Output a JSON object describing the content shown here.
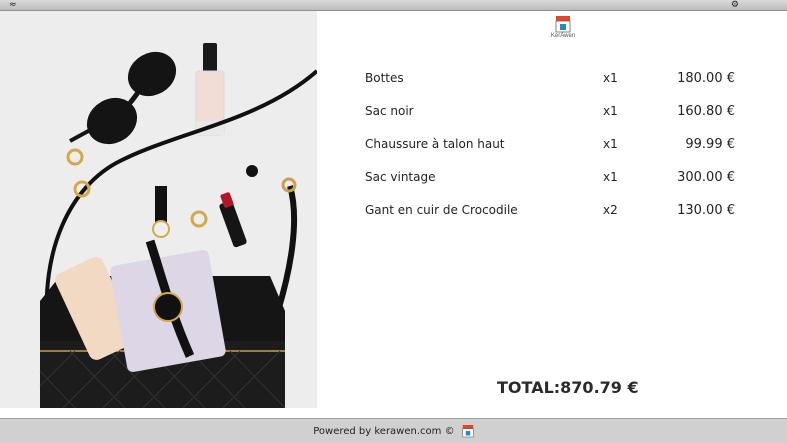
{
  "system_bar": {
    "wifi_icon": "wifi-icon",
    "settings_icon": "gear-icon"
  },
  "logo": {
    "text": "KerAwen",
    "icon": "shop-storefront-icon"
  },
  "photo": {
    "icon": "product-photo-handbag"
  },
  "cart": {
    "items": [
      {
        "name": "Bottes",
        "qty": "x1",
        "price": "180.00 €"
      },
      {
        "name": "Sac noir",
        "qty": "x1",
        "price": "160.80 €"
      },
      {
        "name": "Chaussure à talon haut",
        "qty": "x1",
        "price": "99.99 €"
      },
      {
        "name": "Sac vintage",
        "qty": "x1",
        "price": "300.00 €"
      },
      {
        "name": "Gant en cuir de Crocodile",
        "qty": "x2",
        "price": "130.00 €"
      }
    ],
    "total": "TOTAL:870.79 €"
  },
  "footer": {
    "text": "Powered by kerawen.com ©"
  },
  "colors": {
    "accent_red": "#e5432b",
    "accent_blue": "#2b86c5",
    "footer_bg": "#d0d0d0"
  }
}
